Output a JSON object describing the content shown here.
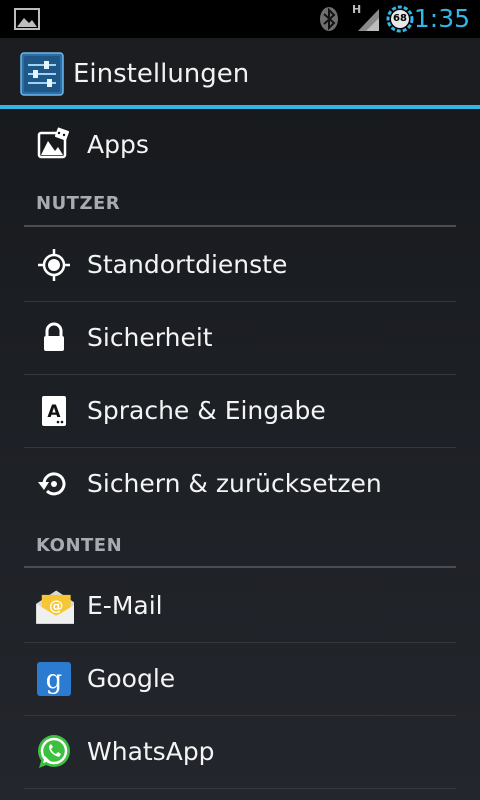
{
  "status_bar": {
    "time": "1:35",
    "network_type": "H",
    "battery_level": "68",
    "icons": [
      "gallery-icon",
      "bluetooth-icon",
      "signal-icon",
      "battery-icon"
    ]
  },
  "action_bar": {
    "title": "Einstellungen",
    "icon": "settings-sliders-icon",
    "accent_color": "#33b5e5"
  },
  "items_top": [
    {
      "label": "Apps",
      "icon": "apps-icon"
    }
  ],
  "sections": [
    {
      "header": "NUTZER",
      "items": [
        {
          "label": "Standortdienste",
          "icon": "location-icon"
        },
        {
          "label": "Sicherheit",
          "icon": "lock-icon"
        },
        {
          "label": "Sprache & Eingabe",
          "icon": "keyboard-a-icon"
        },
        {
          "label": "Sichern & zurücksetzen",
          "icon": "backup-restore-icon"
        }
      ]
    },
    {
      "header": "KONTEN",
      "items": [
        {
          "label": "E-Mail",
          "icon": "email-icon"
        },
        {
          "label": "Google",
          "icon": "google-icon"
        },
        {
          "label": "WhatsApp",
          "icon": "whatsapp-icon"
        }
      ]
    }
  ]
}
